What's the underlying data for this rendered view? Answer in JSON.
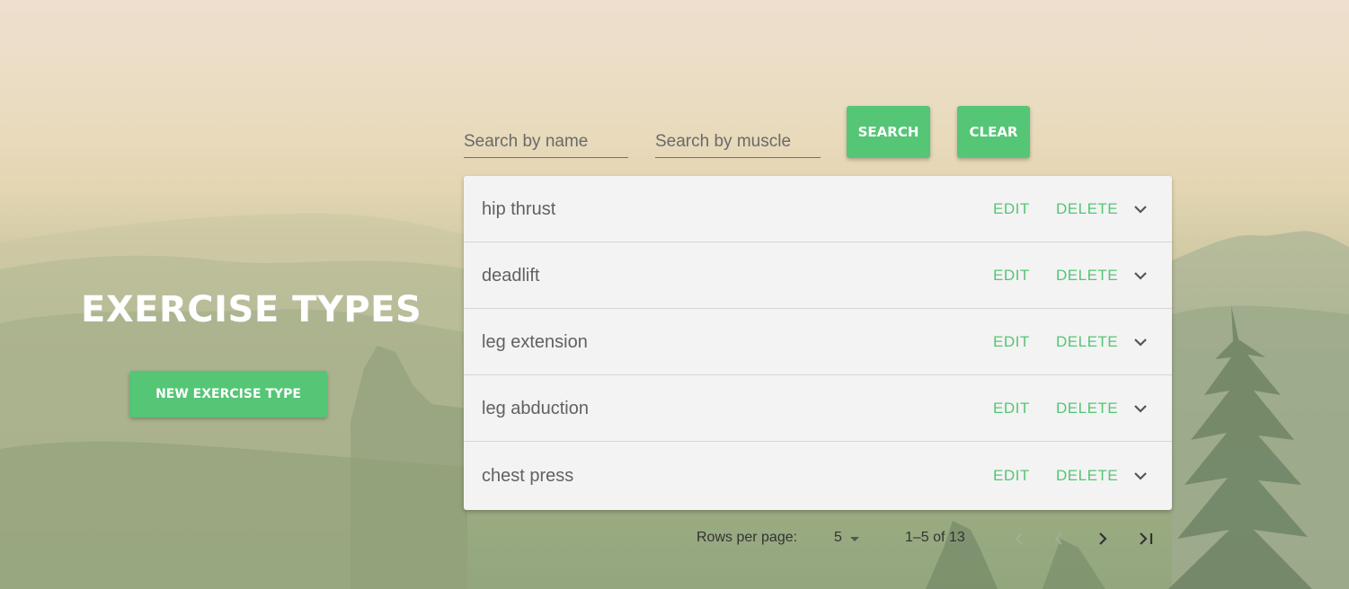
{
  "page": {
    "title": "EXERCISE TYPES",
    "new_button_label": "NEW EXERCISE TYPE"
  },
  "search": {
    "name_placeholder": "Search by name",
    "muscle_placeholder": "Search by muscle",
    "search_label": "SEARCH",
    "clear_label": "CLEAR"
  },
  "rows": [
    {
      "name": "hip thrust",
      "edit": "EDIT",
      "delete": "DELETE",
      "expand_icon": "chevron-down-icon"
    },
    {
      "name": "deadlift",
      "edit": "EDIT",
      "delete": "DELETE",
      "expand_icon": "chevron-down-icon"
    },
    {
      "name": "leg extension",
      "edit": "EDIT",
      "delete": "DELETE",
      "expand_icon": "chevron-down-icon"
    },
    {
      "name": "leg abduction",
      "edit": "EDIT",
      "delete": "DELETE",
      "expand_icon": "chevron-down-icon"
    },
    {
      "name": "chest press",
      "edit": "EDIT",
      "delete": "DELETE",
      "expand_icon": "chevron-down-icon"
    }
  ],
  "pagination": {
    "rows_per_page_label": "Rows per page:",
    "rows_per_page_value": "5",
    "range_text": "1–5 of 13",
    "icons": [
      "first-page-icon",
      "previous-page-icon",
      "next-page-icon",
      "last-page-icon"
    ]
  },
  "colors": {
    "accent": "#55c576",
    "row_background": "#f3f3f3",
    "text": "#616161"
  }
}
